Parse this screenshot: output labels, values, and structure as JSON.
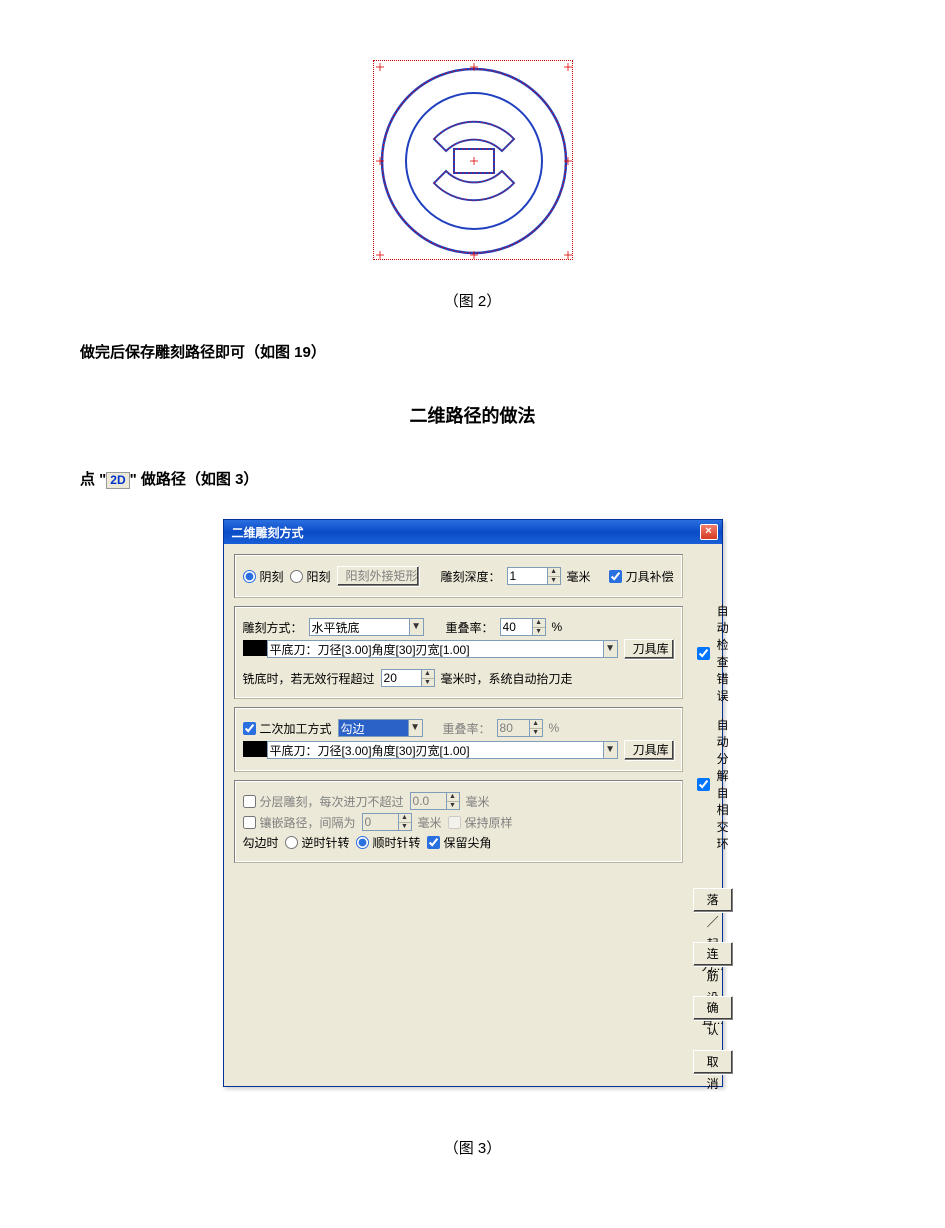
{
  "figure1_caption": "（图 2）",
  "para_after_fig1": "做完后保存雕刻路径即可（如图 19）",
  "heading_2d": "二维路径的做法",
  "para_click_prefix": "点 \"",
  "icon_2d_label": "2D",
  "para_click_suffix": "\" 做路径（如图 3）",
  "figure3_caption": "（图 3）",
  "dialog": {
    "title": "二维雕刻方式",
    "close_symbol": "×",
    "group1": {
      "radio_yinke": "阴刻",
      "radio_yangke": "阳刻",
      "btn_yangke_rect": "阳刻外接矩形",
      "label_depth": "雕刻深度：",
      "depth_value": "1",
      "unit_mm": "毫米",
      "chk_tool_comp": "刀具补偿"
    },
    "group2": {
      "label_method": "雕刻方式：",
      "method_value": "水平铣底",
      "label_overlap": "重叠率：",
      "overlap_value": "40",
      "percent": "%",
      "tool_desc": "平底刀：刀径[3.00]角度[30]刃宽[1.00]",
      "btn_tool_lib": "刀具库"
    },
    "milling_row": {
      "prefix": "铣底时，若无效行程超过",
      "value": "20",
      "mid": "毫米时，系统自动抬刀走",
      "suffix": ""
    },
    "group3": {
      "chk_secondary": "二次加工方式",
      "secondary_value": "勾边",
      "label_overlap": "重叠率：",
      "overlap_value": "80",
      "percent": "%",
      "tool_desc": "平底刀：刀径[3.00]角度[30]刃宽[1.00]",
      "btn_tool_lib": "刀具库"
    },
    "group4": {
      "chk_layer": "分层雕刻，每次进刀不超过",
      "layer_value": "0.0",
      "unit_mm": "毫米",
      "chk_inlay": "镶嵌路径，间隔为",
      "inlay_value": "0",
      "inlay_unit": "毫米",
      "chk_keep_orig": "保持原样",
      "label_goubian": "勾边时",
      "radio_ccw": "逆时针转",
      "radio_cw": "顺时针转",
      "chk_keep_corner": "保留尖角"
    },
    "right": {
      "chk_auto_check": "自动检查错误",
      "chk_auto_split": "自动分解自相交环",
      "btn_drop_raise": "落／起刀...",
      "btn_lianjin": "连筋设置...",
      "btn_ok": "确认",
      "btn_cancel": "取消"
    }
  }
}
